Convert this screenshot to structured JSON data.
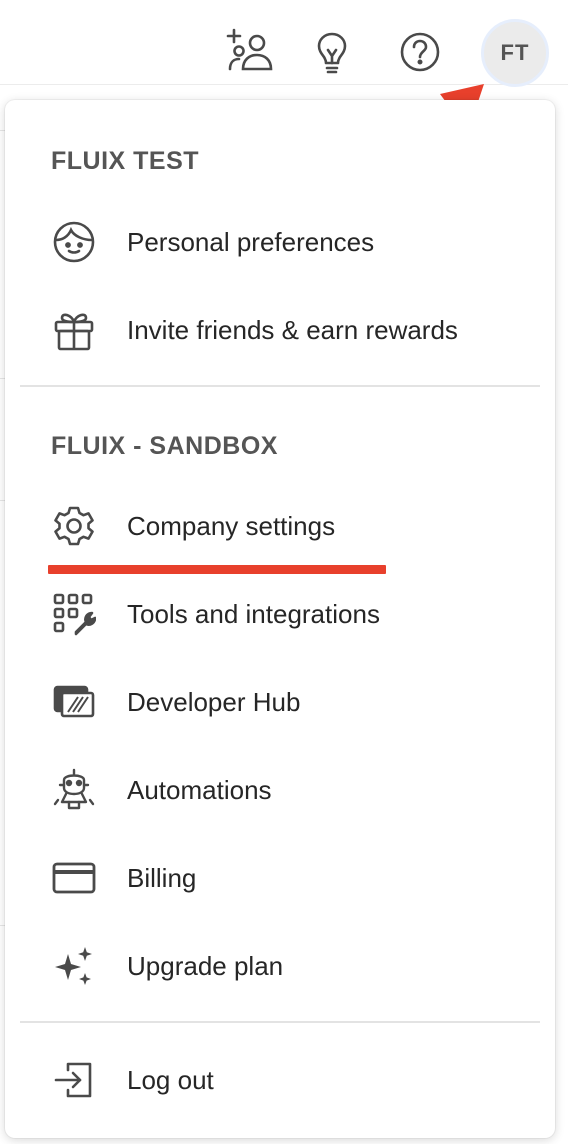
{
  "header": {
    "invite_icon": "add-user-icon",
    "ideas_icon": "lightbulb-icon",
    "help_icon": "question-circle-icon",
    "avatar_initials": "FT"
  },
  "menu": {
    "section1_title": "FLUIX TEST",
    "section1_items": [
      {
        "label": "Personal preferences",
        "icon": "face-icon"
      },
      {
        "label": "Invite friends & earn rewards",
        "icon": "gift-icon"
      }
    ],
    "section2_title": "FLUIX - SANDBOX",
    "section2_items": [
      {
        "label": "Company settings",
        "icon": "gear-icon"
      },
      {
        "label": "Tools and integrations",
        "icon": "tools-grid-icon"
      },
      {
        "label": "Developer Hub",
        "icon": "developer-hub-icon"
      },
      {
        "label": "Automations",
        "icon": "robot-icon"
      },
      {
        "label": "Billing",
        "icon": "credit-card-icon"
      },
      {
        "label": "Upgrade plan",
        "icon": "sparkles-icon"
      }
    ],
    "logout_label": "Log out",
    "logout_icon": "logout-icon"
  },
  "colors": {
    "annotation": "#e8402c",
    "icon": "#4a4a4a",
    "section_title": "#555555"
  }
}
